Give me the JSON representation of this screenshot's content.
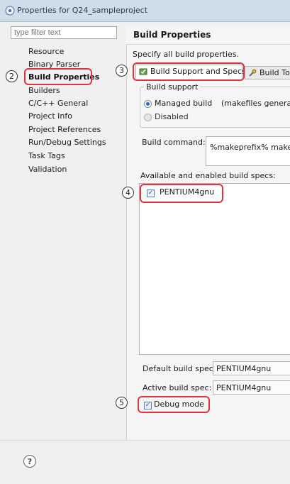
{
  "window": {
    "title": "Properties for Q24_sampleproject",
    "icon": "properties-icon"
  },
  "filter": {
    "placeholder": "type filter text"
  },
  "nav": {
    "items": [
      "Resource",
      "Binary Parser",
      "Build Properties",
      "Builders",
      "C/C++ General",
      "Project Info",
      "Project References",
      "Run/Debug Settings",
      "Task Tags",
      "Validation"
    ],
    "selected": "Build Properties"
  },
  "callouts": {
    "c2": "2",
    "c3": "3",
    "c4": "4",
    "c5": "5"
  },
  "page": {
    "heading": "Build Properties",
    "description": "Specify all build properties."
  },
  "tabs": [
    {
      "label": "Build Support and Specs",
      "icon": "build-support-icon"
    },
    {
      "label": "Build To",
      "icon": "build-tools-icon"
    }
  ],
  "build_support": {
    "group_label": "Build support",
    "managed_label": "Managed build",
    "managed_note": "(makefiles generate",
    "disabled_label": "Disabled"
  },
  "build_command": {
    "label": "Build command:",
    "value": "%makeprefix% make"
  },
  "specs": {
    "label": "Available and enabled build specs:",
    "items": [
      {
        "name": "PENTIUM4gnu",
        "checked": true
      }
    ]
  },
  "default_spec": {
    "label": "Default build spec:",
    "value": "PENTIUM4gnu"
  },
  "active_spec": {
    "label": "Active build spec:",
    "value": "PENTIUM4gnu"
  },
  "debug_mode": {
    "label": "Debug mode",
    "checked": true
  },
  "help": {
    "glyph": "?"
  },
  "colors": {
    "highlight": "#e0353e",
    "accent": "#2b66c4"
  }
}
